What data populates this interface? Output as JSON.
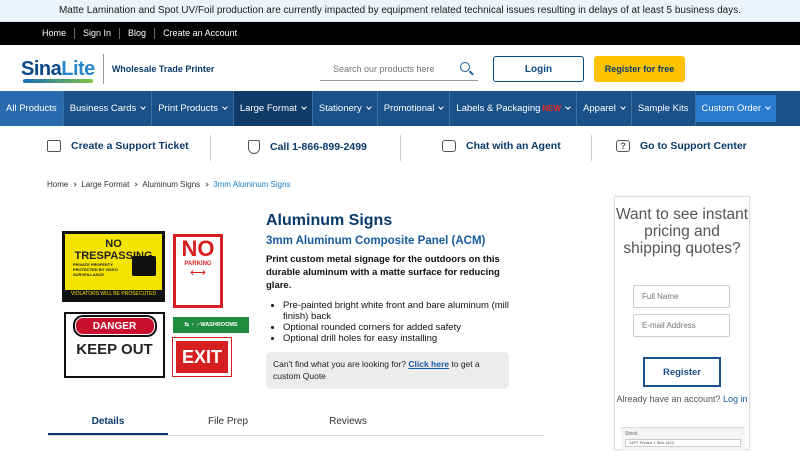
{
  "notice": "Matte Lamination and Spot UV/Foil production are currently impacted by equipment related technical issues resulting in delays of at least 5 business days.",
  "topnav": [
    "Home",
    "Sign In",
    "Blog",
    "Create an Account"
  ],
  "logo": {
    "part1": "Sina",
    "part2": "Lite",
    "tagline": "Wholesale Trade Printer"
  },
  "search": {
    "placeholder": "Search our products here"
  },
  "header_buttons": {
    "login": "Login",
    "register": "Register for free"
  },
  "mainnav": [
    {
      "label": "All Products"
    },
    {
      "label": "Business Cards"
    },
    {
      "label": "Print Products"
    },
    {
      "label": "Large Format"
    },
    {
      "label": "Stationery"
    },
    {
      "label": "Promotional"
    },
    {
      "label": "Labels & Packaging",
      "badge": "NEW"
    },
    {
      "label": "Apparel"
    },
    {
      "label": "Sample Kits"
    },
    {
      "label": "Custom Order"
    }
  ],
  "support": {
    "ticket": "Create a Support Ticket",
    "call": "Call 1-866-899-2499",
    "chat": "Chat with an Agent",
    "center": "Go to Support Center"
  },
  "breadcrumbs": [
    "Home",
    "Large Format",
    "Aluminum Signs",
    "3mm Aluminum Signs"
  ],
  "signs": {
    "trespass": "NO TRESPASSING",
    "trespass_text": "PRIVATE PROPERTY PROTECTED BY VIDEO SURVEILLANCE",
    "trespass_bottom": "VIOLATORS WILL BE PROSECUTED",
    "no": "NO",
    "parking": "PARKING",
    "danger": "DANGER",
    "keep_out": "KEEP OUT",
    "washrooms": "WASHROOMS",
    "exit": "EXIT"
  },
  "product": {
    "title": "Aluminum Signs",
    "subtitle": "3mm Aluminum Composite Panel (ACM)",
    "description": "Print custom metal signage for the outdoors on this durable aluminum with a matte surface for reducing glare.",
    "features": [
      "Pre-painted bright white front and bare aluminum (mill finish) back",
      "Optional rounded corners for added safety",
      "Optional drill holes for easy installing"
    ],
    "cant_find": "Can't find what you are looking for?",
    "click_here": "Click here",
    "cant_find_after": "to get a custom Quote"
  },
  "tabs": [
    "Details",
    "File Prep",
    "Reviews"
  ],
  "pricing_panel": {
    "heading": "Want to see instant pricing and shipping quotes?",
    "fullname_placeholder": "Full Name",
    "email_placeholder": "E-mail Address",
    "register": "Register",
    "already": "Already have an account?",
    "login": "Log in",
    "mini_label": "Stock",
    "mini_select": "14PT Printed 1 Side (4/0)"
  },
  "colors": {
    "nav_bg": "#1a5189",
    "accent_yellow": "#fdc300",
    "brand_blue": "#0a3a6a"
  }
}
